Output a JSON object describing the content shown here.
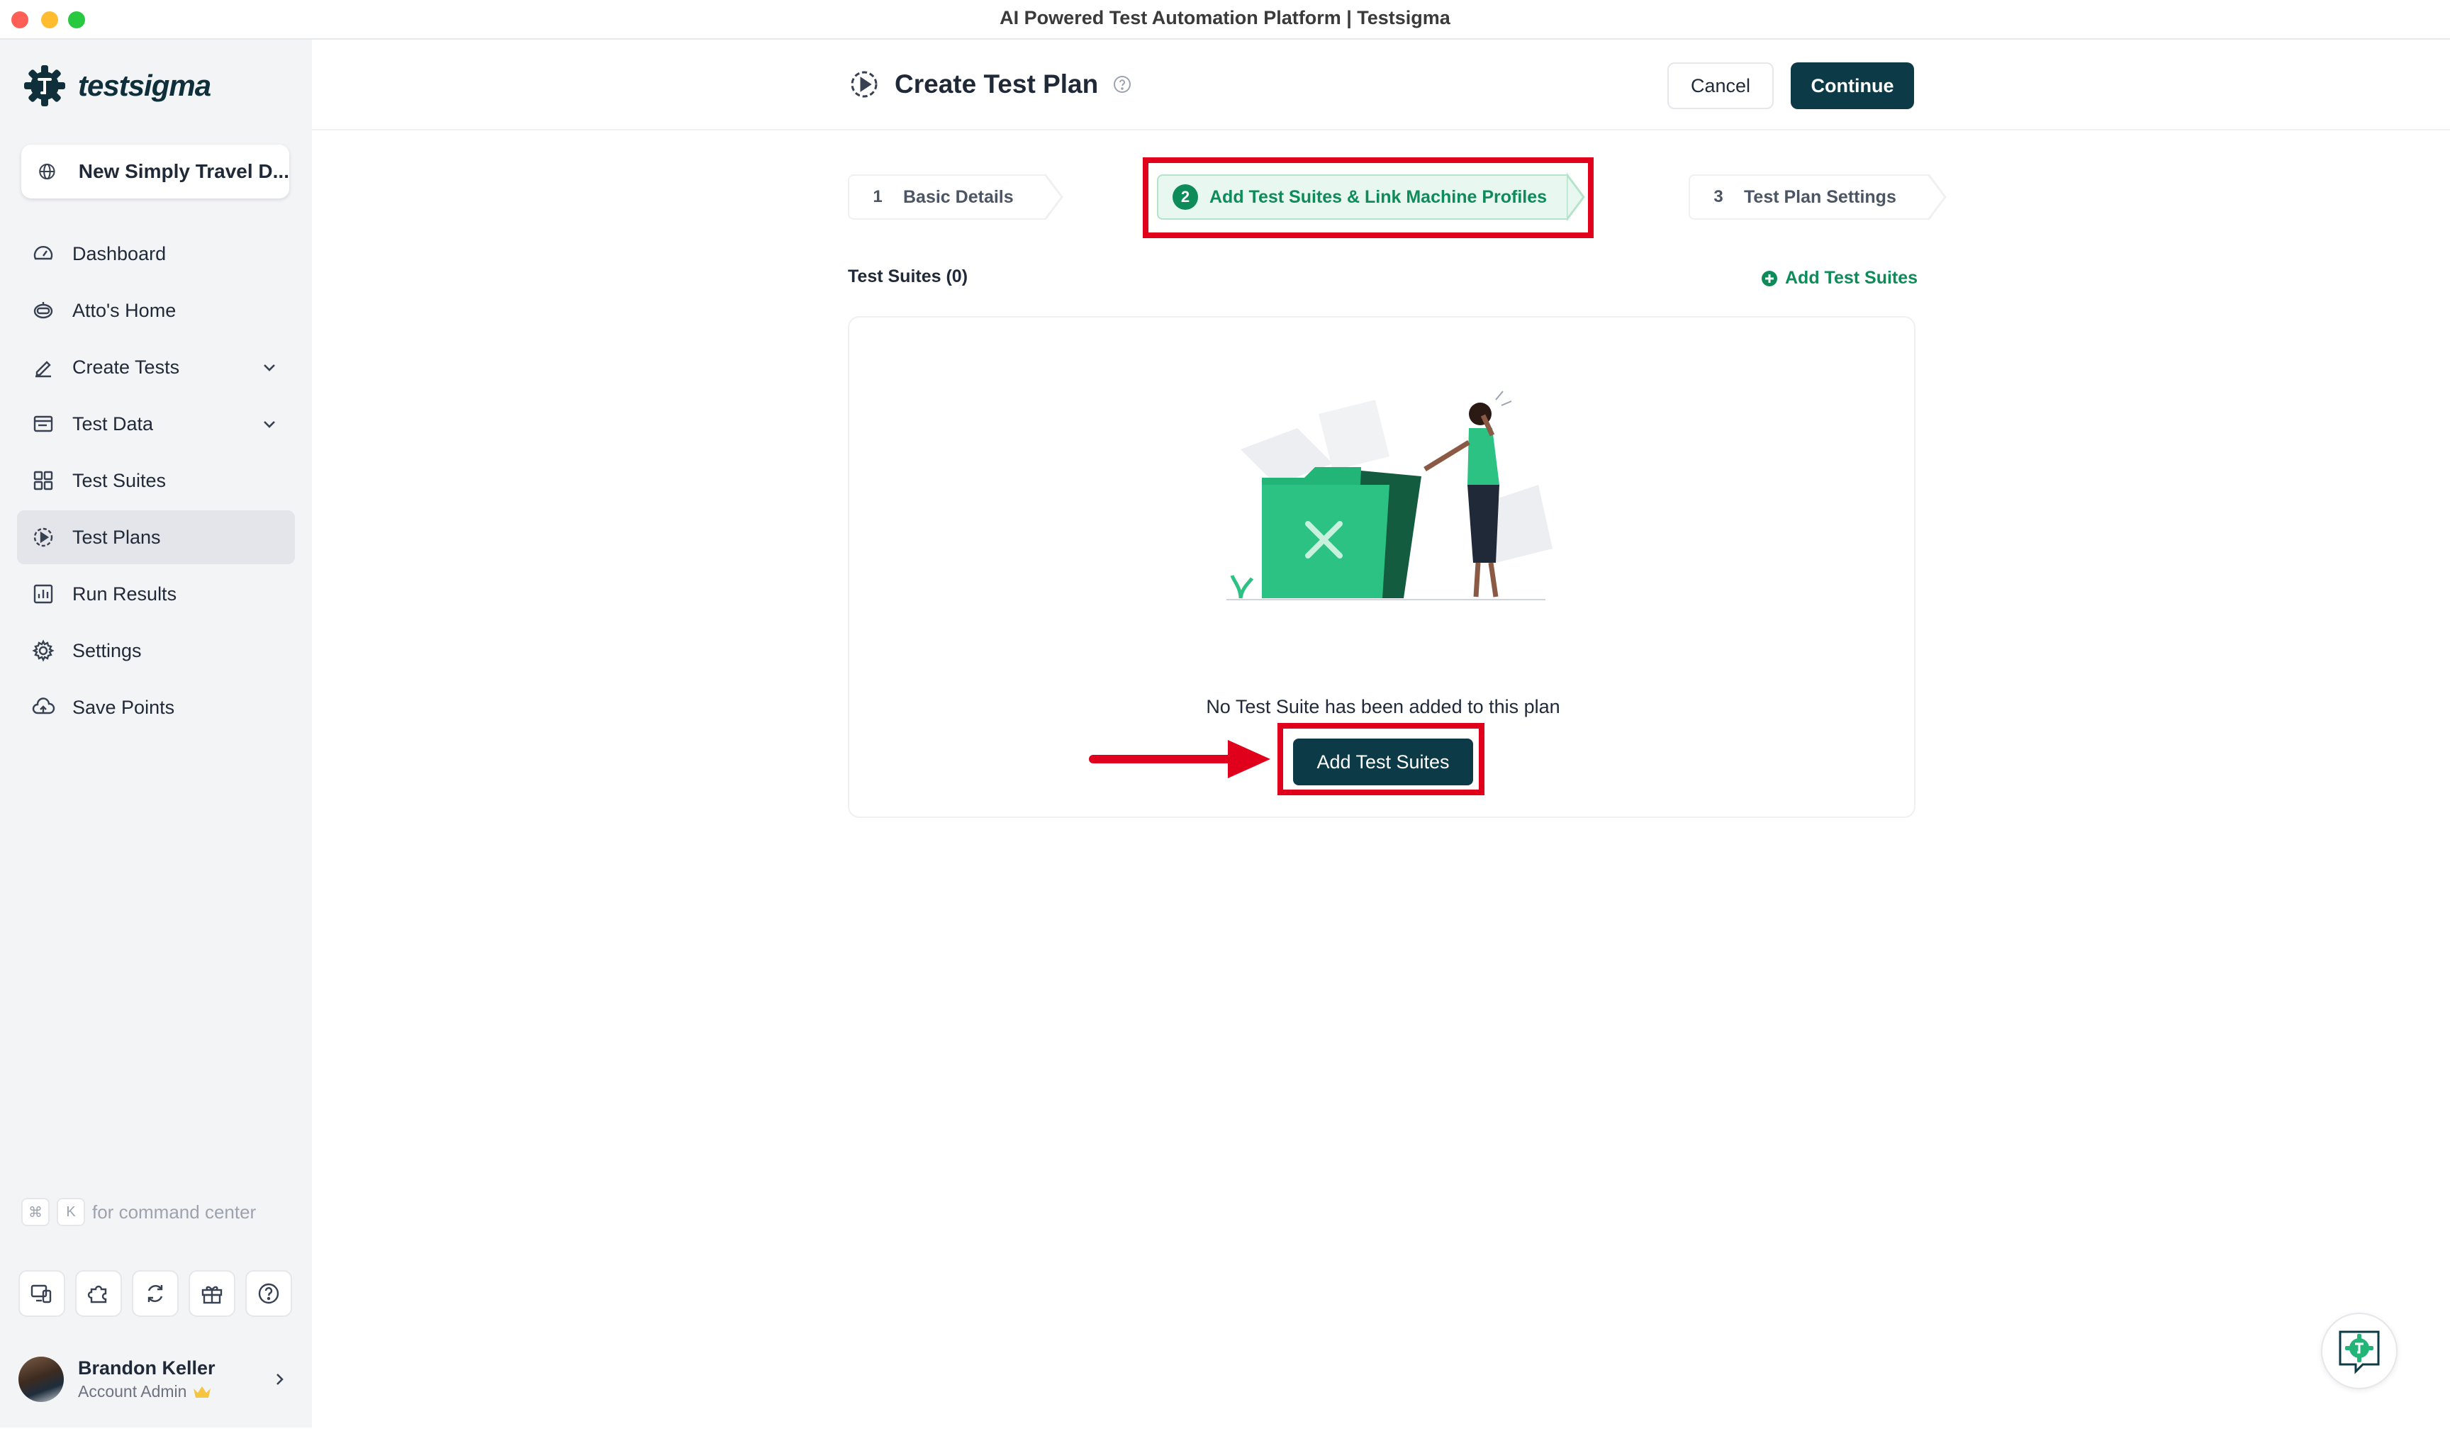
{
  "window": {
    "title": "AI Powered Test Automation Platform | Testsigma"
  },
  "brand": {
    "name": "testsigma",
    "color": "#0f2f3a",
    "accent": "#0d8c5a"
  },
  "sidebar": {
    "project": {
      "label": "New Simply Travel D...",
      "icon": "globe-icon"
    },
    "items": [
      {
        "label": "Dashboard",
        "icon": "speedometer-icon"
      },
      {
        "label": "Atto's Home",
        "icon": "robot-icon"
      },
      {
        "label": "Create Tests",
        "icon": "pencil-icon",
        "expandable": true
      },
      {
        "label": "Test Data",
        "icon": "table-icon",
        "expandable": true
      },
      {
        "label": "Test Suites",
        "icon": "grid-icon"
      },
      {
        "label": "Test Plans",
        "icon": "play-circle-icon",
        "active": true
      },
      {
        "label": "Run Results",
        "icon": "chart-icon"
      },
      {
        "label": "Settings",
        "icon": "gear-icon"
      },
      {
        "label": "Save Points",
        "icon": "cloud-upload-icon"
      }
    ],
    "command": {
      "key1": "⌘",
      "key2": "K",
      "text": "for command center"
    },
    "user": {
      "name": "Brandon Keller",
      "role": "Account Admin"
    }
  },
  "header": {
    "title": "Create Test Plan",
    "cancel_label": "Cancel",
    "continue_label": "Continue"
  },
  "steps": [
    {
      "num": "1",
      "label": "Basic Details"
    },
    {
      "num": "2",
      "label": "Add Test Suites & Link Machine Profiles",
      "active": true
    },
    {
      "num": "3",
      "label": "Test Plan Settings"
    }
  ],
  "test_suites": {
    "title": "Test Suites (0)",
    "add_link": "Add Test Suites",
    "empty_text": "No Test Suite has been added to this plan",
    "add_button": "Add Test Suites"
  },
  "annotation_color": "#e0001b"
}
